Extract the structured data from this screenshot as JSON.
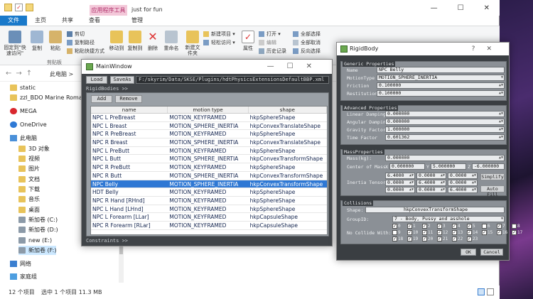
{
  "explorer": {
    "app_tools_tab": "应用程序工具",
    "window_title": "just for fun",
    "tabs": [
      "文件",
      "主页",
      "共享",
      "查看",
      "管理"
    ],
    "ribbon": {
      "pin_label": "固定到\"快速访问\"",
      "copy_label": "复制",
      "paste_label": "粘贴",
      "cut_label": "剪切",
      "copy_path_label": "复制路径",
      "paste_shortcut_label": "粘贴快捷方式",
      "clipboard_group": "剪贴板",
      "move_to_label": "移动到",
      "copy_to_label": "复制到",
      "delete_label": "删除",
      "rename_label": "重命名",
      "new_item_label": "新建项目",
      "easy_access_label": "轻松访问",
      "new_folder_label": "新建文件夹",
      "properties_label": "属性",
      "open_label": "打开",
      "edit_label": "编辑",
      "history_label": "历史记录",
      "select_all_label": "全部选择",
      "select_none_label": "全部取消",
      "invert_label": "反向选择"
    },
    "address": "此电脑 >",
    "nav_items": [
      {
        "label": "static",
        "icon": "folder-icon"
      },
      {
        "label": "zzl_BDO Marine Romance",
        "icon": "folder-icon"
      },
      {
        "label": "MEGA",
        "icon": "mega-icon"
      },
      {
        "label": "OneDrive",
        "icon": "cloud-icon"
      },
      {
        "label": "此电脑",
        "icon": "computer-icon"
      },
      {
        "label": "3D 对象",
        "icon": "folder-icon"
      },
      {
        "label": "视频",
        "icon": "folder-icon"
      },
      {
        "label": "图片",
        "icon": "folder-icon"
      },
      {
        "label": "文档",
        "icon": "folder-icon"
      },
      {
        "label": "下载",
        "icon": "folder-icon"
      },
      {
        "label": "音乐",
        "icon": "folder-icon"
      },
      {
        "label": "桌面",
        "icon": "folder-icon"
      },
      {
        "label": "新加卷 (C:)",
        "icon": "drive-icon"
      },
      {
        "label": "新加卷 (D:)",
        "icon": "drive-icon"
      },
      {
        "label": "new (E:)",
        "icon": "drive-icon"
      },
      {
        "label": "新加卷 (F:)",
        "icon": "drive-icon"
      },
      {
        "label": "网络",
        "icon": "network-icon"
      },
      {
        "label": "家庭组",
        "icon": "homegroup-icon"
      }
    ],
    "status_count": "12 个项目",
    "status_selection": "选中 1 个项目  11.3 MB"
  },
  "main_window": {
    "title": "MainWindow",
    "load_label": "Load",
    "save_label": "SaveAs",
    "path": "F:/skyrim/Data/SKSE/Plugins/hdtPhysicsExtensionsDefaultBBP.xml",
    "rigidbodies_label": "RigidBodies >>",
    "add_label": "Add",
    "remove_label": "Remove",
    "constraints_label": "Constraints >>",
    "columns": [
      "name",
      "motion type",
      "shape"
    ],
    "rows": [
      [
        "NPC L PreBreast",
        "MOTION_KEYFRAMED",
        "hkpSphereShape"
      ],
      [
        "NPC L Breast",
        "MOTION_SPHERE_INERTIA",
        "hkpConvexTranslateShape"
      ],
      [
        "NPC R PreBreast",
        "MOTION_KEYFRAMED",
        "hkpSphereShape"
      ],
      [
        "NPC R Breast",
        "MOTION_SPHERE_INERTIA",
        "hkpConvexTranslateShape"
      ],
      [
        "NPC L PreButt",
        "MOTION_KEYFRAMED",
        "hkpSphereShape"
      ],
      [
        "NPC L Butt",
        "MOTION_SPHERE_INERTIA",
        "hkpConvexTransformShape"
      ],
      [
        "NPC R PreButt",
        "MOTION_KEYFRAMED",
        "hkpSphereShape"
      ],
      [
        "NPC R Butt",
        "MOTION_SPHERE_INERTIA",
        "hkpConvexTransformShape"
      ],
      [
        "NPC Belly",
        "MOTION_SPHERE_INERTIA",
        "hkpConvexTransformShape"
      ],
      [
        "HDT Belly",
        "MOTION_KEYFRAMED",
        "hkpSphereShape"
      ],
      [
        "NPC R Hand [RHnd]",
        "MOTION_KEYFRAMED",
        "hkpSphereShape"
      ],
      [
        "NPC L Hand [LHnd]",
        "MOTION_KEYFRAMED",
        "hkpSphereShape"
      ],
      [
        "NPC L Forearm [LLar]",
        "MOTION_KEYFRAMED",
        "hkpCapsuleShape"
      ],
      [
        "NPC R Forearm [RLar]",
        "MOTION_KEYFRAMED",
        "hkpCapsuleShape"
      ]
    ],
    "selected_row": 8
  },
  "rigid_body": {
    "title": "RigidBody",
    "help": "?",
    "generic_label": "Generic Properties",
    "name_label": "Name",
    "name_value": "NPC Belly",
    "motion_label": "MotionType",
    "motion_value": "MOTION_SPHERE_INERTIA",
    "friction_label": "Friction",
    "friction_value": "0.100000",
    "restitution_label": "Restitution",
    "restitution_value": "0.100000",
    "advanced_label": "Advanced Properties",
    "linear_label": "Linear Damping",
    "linear_value": "0.000000",
    "angular_label": "Angular Damping",
    "angular_value": "0.000000",
    "gravity_label": "Gravity Factor",
    "gravity_value": "1.000000",
    "time_label": "Time Factor",
    "time_value": "0.601362",
    "mass_group_label": "MassProperties",
    "mass_label": "Mass(kg):",
    "mass_value": "0.000000",
    "com_label": "Center of Mass:",
    "com_x_label": "X",
    "com_x": "0.000000",
    "com_y_label": "Y",
    "com_y": "5.000000",
    "com_z_label": "Z",
    "com_z": "-6.000000",
    "inertia_label": "Inertia Tensor:",
    "inertia": [
      [
        "6.4000",
        "0.0000",
        "0.0000"
      ],
      [
        "0.0000",
        "6.4000",
        "0.0000"
      ],
      [
        "0.0000",
        "0.0000",
        "6.4000"
      ]
    ],
    "simplify_label": "Simplify",
    "autofill_label": "Auto Fill",
    "collisions_label": "Collisions",
    "shape_label": "Shape:",
    "shape_value": "hkpConvexTransformShape",
    "group_label": "GroupID:",
    "group_value": "7 - Body, Pussy and asshole",
    "nocollide_label": "No Collide With:",
    "nocollide": [
      [
        [
          "0",
          true
        ],
        [
          "1",
          true
        ],
        [
          "2",
          true
        ],
        [
          "3",
          true
        ],
        [
          "4",
          true
        ],
        [
          "5",
          true
        ],
        [
          "6",
          false
        ],
        [
          "7",
          true
        ],
        [
          "8",
          false
        ]
      ],
      [
        [
          "9",
          false
        ],
        [
          "10",
          true
        ],
        [
          "11",
          true
        ],
        [
          "12",
          true
        ],
        [
          "13",
          true
        ],
        [
          "14",
          true
        ],
        [
          "15",
          true
        ],
        [
          "16",
          true
        ],
        [
          "17",
          true
        ]
      ],
      [
        [
          "18",
          true
        ],
        [
          "19",
          true
        ],
        [
          "20",
          true
        ],
        [
          "21",
          true
        ],
        [
          "22",
          true
        ],
        [
          "23",
          true
        ]
      ]
    ],
    "ok_label": "OK",
    "cancel_label": "Cancel"
  }
}
